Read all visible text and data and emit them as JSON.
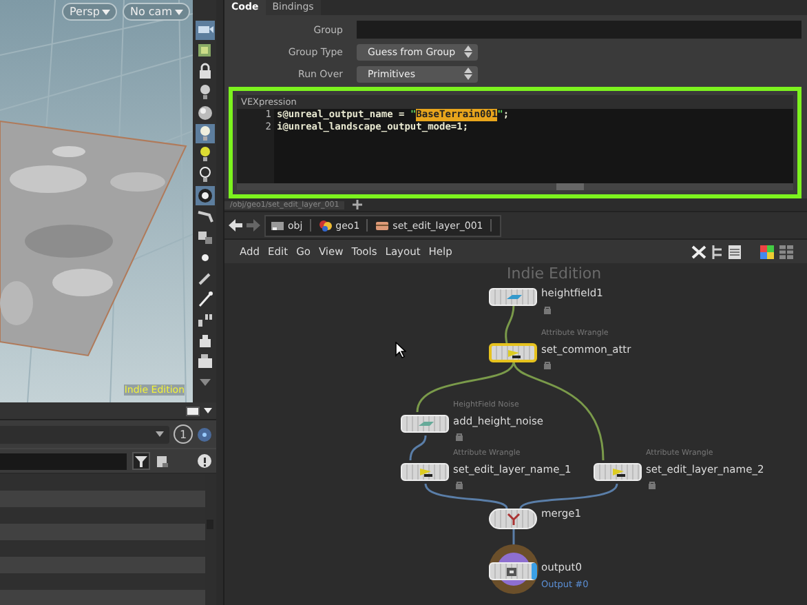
{
  "viewport": {
    "camera_menus": [
      {
        "label": "Persp"
      },
      {
        "label": "No cam"
      }
    ],
    "watermark": "Indie Edition",
    "tools": [
      {
        "selected": true
      },
      {
        "selected": false
      },
      {
        "selected": false
      },
      {
        "selected": false
      },
      {
        "selected": false
      },
      {
        "selected": true
      },
      {
        "selected": false
      },
      {
        "selected": false
      },
      {
        "selected": true
      },
      {
        "selected": false
      },
      {
        "selected": false
      },
      {
        "selected": false
      },
      {
        "selected": false
      },
      {
        "selected": false
      },
      {
        "selected": false
      },
      {
        "selected": false
      },
      {
        "selected": false
      },
      {
        "selected": false
      }
    ]
  },
  "lower_panel": {
    "badge": "1"
  },
  "parameters": {
    "tabs": [
      {
        "label": "Code",
        "selected": true
      },
      {
        "label": "Bindings",
        "selected": false
      }
    ],
    "fields": [
      {
        "kind": "text",
        "label": "Group"
      },
      {
        "kind": "menu",
        "label": "Group Type",
        "value": "Guess from Group"
      },
      {
        "kind": "menu",
        "label": "Run Over",
        "value": "Primitives"
      }
    ],
    "vexpression": {
      "label": "VEXpression",
      "highlighted": true,
      "lines": [
        {
          "number": "1",
          "segments": [
            {
              "kind": "plain",
              "text": "s@unreal_output_name = "
            },
            {
              "kind": "string",
              "text": "\""
            },
            {
              "kind": "selected",
              "text": "BaseTerrain001"
            },
            {
              "kind": "string",
              "text": "\""
            },
            {
              "kind": "plain",
              "text": ";"
            }
          ]
        },
        {
          "number": "2",
          "segments": [
            {
              "kind": "plain",
              "text": "i@unreal_landscape_output_mode=1;"
            }
          ]
        }
      ]
    }
  },
  "network": {
    "path_tab": "/obj/geo1/set_edit_layer_001",
    "breadcrumbs": [
      "obj",
      "geo1",
      "set_edit_layer_001"
    ],
    "menu": [
      "Add",
      "Edit",
      "Go",
      "View",
      "Tools",
      "Layout",
      "Help"
    ],
    "watermark": "Indie Edition",
    "nodes": [
      {
        "kind": "heightfield",
        "name": "heightfield1",
        "selected": false
      },
      {
        "kind": "wrangle",
        "type": "Attribute Wrangle",
        "name": "set_common_attr",
        "selected": true
      },
      {
        "kind": "noise",
        "type": "HeightField Noise",
        "name": "add_height_noise",
        "selected": false
      },
      {
        "kind": "wrangle",
        "type": "Attribute Wrangle",
        "name": "set_edit_layer_name_1",
        "selected": false
      },
      {
        "kind": "wrangle",
        "type": "Attribute Wrangle",
        "name": "set_edit_layer_name_2",
        "selected": false
      },
      {
        "kind": "merge",
        "name": "merge1",
        "selected": false
      },
      {
        "kind": "output",
        "name": "output0",
        "sublabel": "Output #0",
        "selected": false
      }
    ]
  }
}
